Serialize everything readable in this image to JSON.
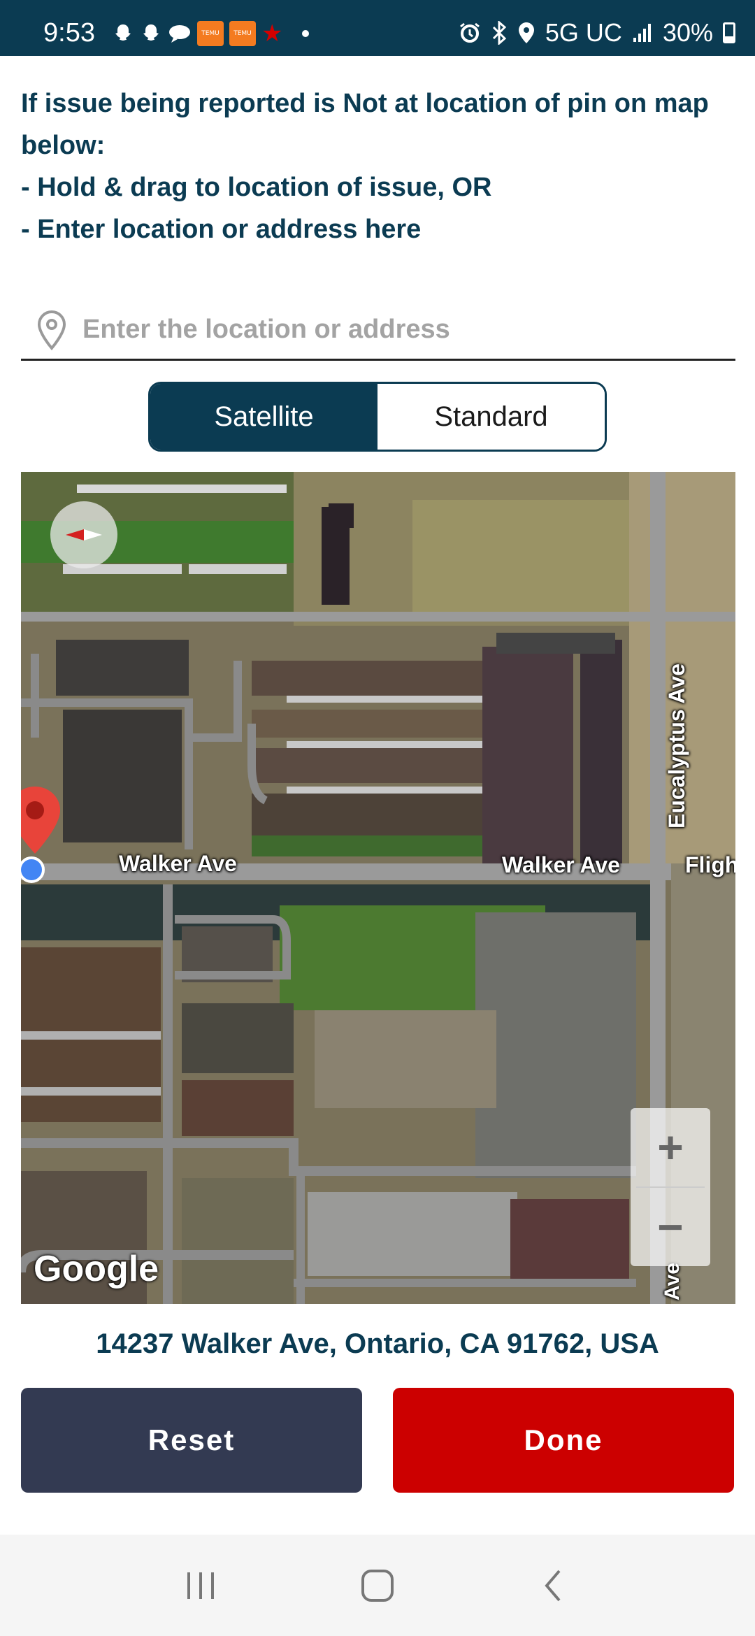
{
  "status_bar": {
    "time": "9:53",
    "network": "5G UC",
    "battery": "30%",
    "temu_label": "TEMU",
    "icons_left": [
      "snapchat-icon",
      "snapchat-icon",
      "chat-icon",
      "temu-icon",
      "temu-icon",
      "star-icon",
      "dot-icon"
    ],
    "icons_right": [
      "alarm-icon",
      "bluetooth-icon",
      "location-icon",
      "signal-icon",
      "battery-icon"
    ]
  },
  "instructions": {
    "line1": "If issue being reported is Not at location of pin on map below:",
    "line2": "- Hold & drag to location of issue, OR",
    "line3": "- Enter location or address here"
  },
  "search": {
    "placeholder": "Enter the location or address",
    "value": ""
  },
  "map_type": {
    "options": [
      "Satellite",
      "Standard"
    ],
    "selected": "Satellite"
  },
  "map": {
    "streets": {
      "walker_1": "Walker Ave",
      "walker_2": "Walker Ave",
      "flight": "Fligh",
      "eucalyptus": "Eucalyptus Ave",
      "ave": "Ave"
    },
    "zoom_in": "+",
    "zoom_out": "−",
    "attribution": "Google"
  },
  "address": "14237 Walker Ave, Ontario, CA 91762, USA",
  "actions": {
    "reset": "Reset",
    "done": "Done"
  },
  "colors": {
    "primary": "#0b3b52",
    "done": "#cc0000",
    "reset": "#333a52"
  }
}
